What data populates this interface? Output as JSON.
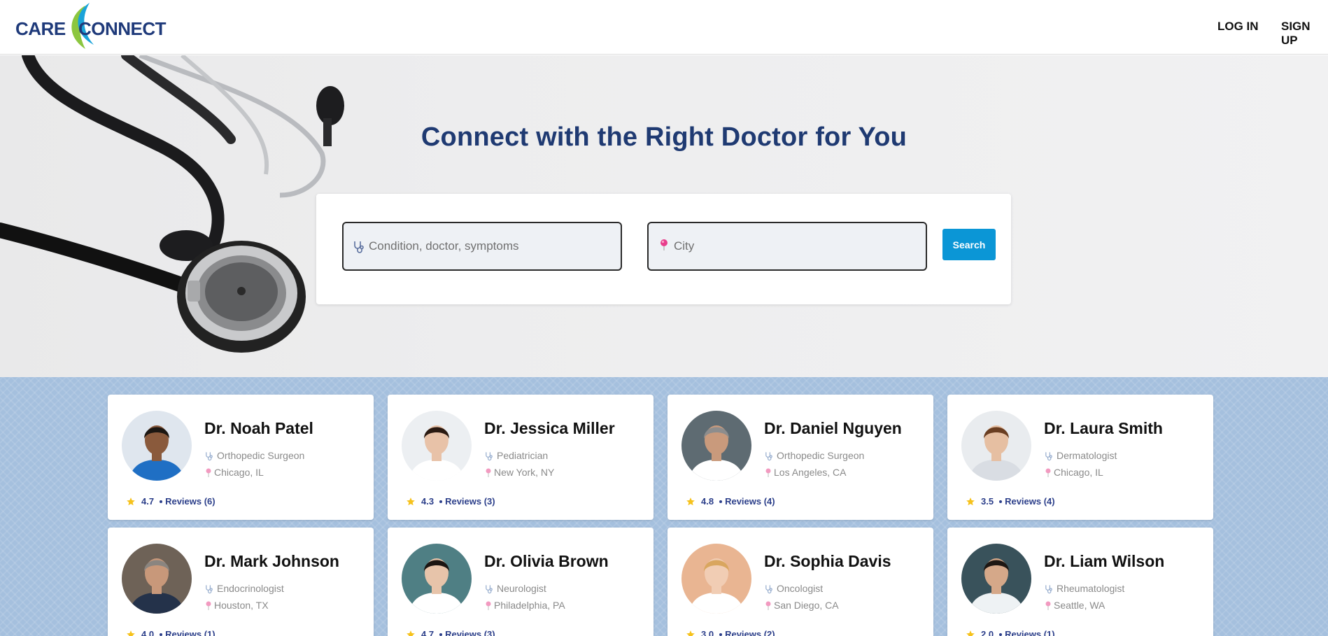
{
  "header": {
    "logo_left": "CARE",
    "logo_right": "CONNECT",
    "login_label": "LOG IN",
    "signup_label": "SIGN UP"
  },
  "hero": {
    "title": "Connect with the Right Doctor for You",
    "condition_placeholder": "Condition, doctor, symptoms",
    "city_placeholder": "City",
    "search_label": "Search"
  },
  "colors": {
    "brand_navy": "#1f3a72",
    "search_button": "#0b96d6",
    "section_bg": "#a5c0de",
    "rating_text": "#2c3f8a",
    "star": "#f6c21c",
    "pin": "#e83e8c"
  },
  "doctors": [
    {
      "name": "Dr. Noah Patel",
      "specialty": "Orthopedic Surgeon",
      "location": "Chicago, IL",
      "rating": "4.7",
      "reviews": "Reviews (6)"
    },
    {
      "name": "Dr. Jessica Miller",
      "specialty": "Pediatrician",
      "location": "New York, NY",
      "rating": "4.3",
      "reviews": "Reviews (3)"
    },
    {
      "name": "Dr. Daniel Nguyen",
      "specialty": "Orthopedic Surgeon",
      "location": "Los Angeles, CA",
      "rating": "4.8",
      "reviews": "Reviews (4)"
    },
    {
      "name": "Dr. Laura Smith",
      "specialty": "Dermatologist",
      "location": "Chicago, IL",
      "rating": "3.5",
      "reviews": "Reviews (4)"
    },
    {
      "name": "Dr. Mark Johnson",
      "specialty": "Endocrinologist",
      "location": "Houston, TX",
      "rating": "4.0",
      "reviews": "Reviews (1)"
    },
    {
      "name": "Dr. Olivia Brown",
      "specialty": "Neurologist",
      "location": "Philadelphia, PA",
      "rating": "4.7",
      "reviews": "Reviews (3)"
    },
    {
      "name": "Dr. Sophia Davis",
      "specialty": "Oncologist",
      "location": "San Diego, CA",
      "rating": "3.0",
      "reviews": "Reviews (2)"
    },
    {
      "name": "Dr. Liam Wilson",
      "specialty": "Rheumatologist",
      "location": "Seattle, WA",
      "rating": "2.0",
      "reviews": "Reviews (1)"
    }
  ]
}
